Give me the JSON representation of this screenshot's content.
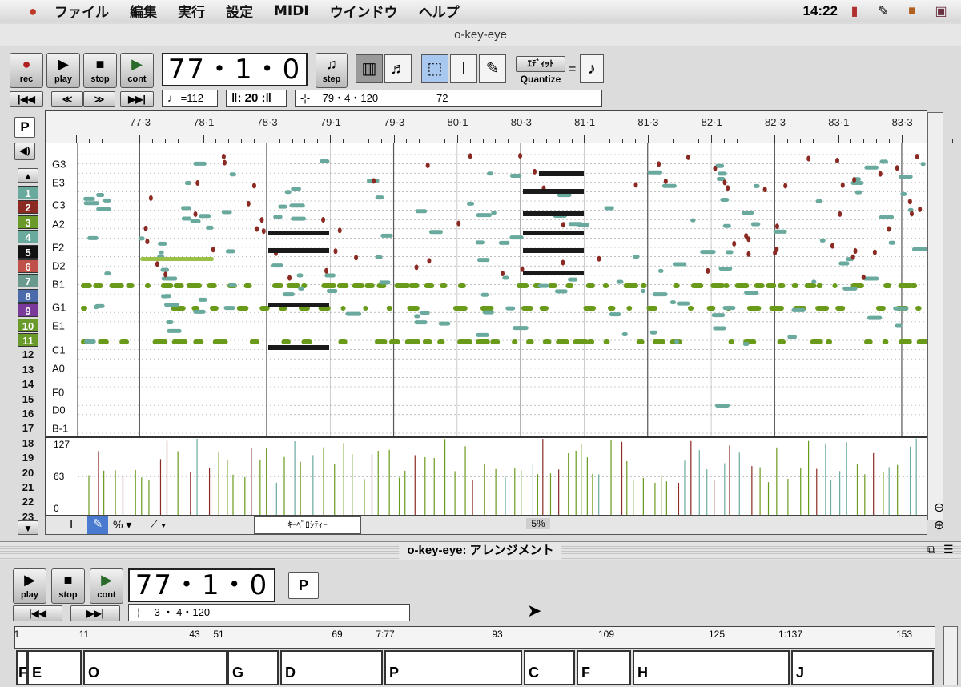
{
  "menubar": {
    "items": [
      "ファイル",
      "編集",
      "実行",
      "設定",
      "MIDI",
      "ウインドウ",
      "ヘルプ"
    ],
    "clock": "14:22"
  },
  "window": {
    "title": "o-key-eye"
  },
  "transport": {
    "rec": "rec",
    "play": "play",
    "stop": "stop",
    "cont": "cont",
    "step": "step",
    "position": "77・1・0",
    "tempo": "=112",
    "grid": "20",
    "cursor_pos": "79・4・120",
    "cursor_value": "72",
    "quantize_label": "Quantize",
    "edit_label": "ｴﾃﾞｨｯﾄ"
  },
  "ruler_labels": [
    "77·3",
    "78·1",
    "78·3",
    "79·1",
    "79·3",
    "80·1",
    "80·3",
    "81·1",
    "81·3",
    "82·1",
    "82·3",
    "83·1",
    "83·3"
  ],
  "pitch_labels": [
    "G3",
    "E3",
    "C3",
    "A2",
    "F2",
    "D2",
    "B1",
    "G1",
    "E1",
    "C1",
    "A0",
    "F0",
    "D0",
    "B-1"
  ],
  "velocity_labels": [
    "127",
    "63",
    "0"
  ],
  "tracks": [
    "1",
    "2",
    "3",
    "4",
    "5",
    "6",
    "7",
    "8",
    "9",
    "10",
    "11",
    "12",
    "13",
    "14",
    "15",
    "16",
    "17",
    "18",
    "19",
    "20",
    "21",
    "22",
    "23"
  ],
  "track_colors": [
    "#6aaa9e",
    "#8a2a22",
    "#6a9a2a",
    "#6aaa9e",
    "#111111",
    "#c0504a",
    "#6a9a8e",
    "#4a6aaa",
    "#7a3a9a",
    "#6a9a2a",
    "#6a9a2a"
  ],
  "p_button": "P",
  "bottom_strip": {
    "mode_label": "ｷｰﾍﾞﾛｼﾃｨｰ",
    "percent": "5%"
  },
  "arrange": {
    "title": "o-key-eye: アレンジメント",
    "play": "play",
    "stop": "stop",
    "cont": "cont",
    "position": "77・1・0",
    "p_button": "P",
    "cursor_pos": "3 ・ 4・120",
    "ruler_labels": [
      "1",
      "11",
      "43",
      "51",
      "69",
      "7:77",
      "93",
      "109",
      "125",
      "1:137",
      "153"
    ],
    "regions": [
      "F",
      "E",
      "O",
      "G",
      "D",
      "P",
      "C",
      "F",
      "H",
      "J"
    ]
  },
  "colors": {
    "note_teal": "#6aaa9e",
    "note_green": "#6a9a1a",
    "note_red": "#8a2a22",
    "note_black": "#1a1a1a"
  }
}
